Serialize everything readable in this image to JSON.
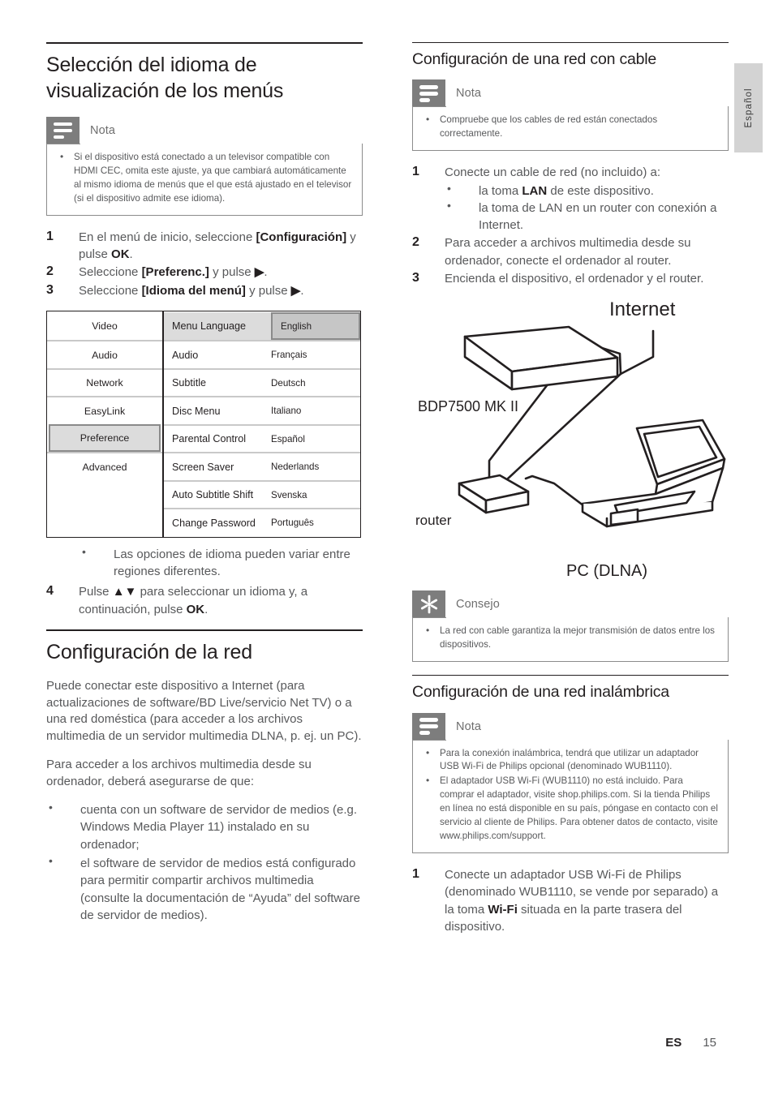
{
  "page": {
    "language_tab": "Español",
    "footer_code": "ES",
    "footer_page": "15"
  },
  "left_column": {
    "heading": "Selección del idioma de visualización de los menús",
    "note": {
      "icon": "note-icon",
      "label": "Nota",
      "items": [
        "Si el dispositivo está conectado a un televisor compatible con HDMI CEC, omita este ajuste, ya que cambiará automáticamente al mismo idioma de menús que el que está ajustado en el televisor (si el dispositivo admite ese idioma)."
      ]
    },
    "steps": [
      {
        "prefix": "En el menú de inicio, seleccione ",
        "bold1": "[Configuración]",
        "middle": " y pulse ",
        "bold2": "OK",
        "suffix": "."
      },
      {
        "prefix": "Seleccione ",
        "bold1": "[Preferenc.]",
        "middle": " y pulse ",
        "bold2": "▶",
        "suffix": "."
      },
      {
        "prefix": "Seleccione ",
        "bold1": "[Idioma del menú]",
        "middle": " y pulse ",
        "bold2": "▶",
        "suffix": "."
      }
    ],
    "osd_menu": {
      "sidebar": [
        {
          "label": "Video",
          "selected": false
        },
        {
          "label": "Audio",
          "selected": false
        },
        {
          "label": "Network",
          "selected": false
        },
        {
          "label": "EasyLink",
          "selected": false
        },
        {
          "label": "Preference",
          "selected": true
        },
        {
          "label": "Advanced",
          "selected": false
        }
      ],
      "rows": [
        {
          "name": "Menu Language",
          "value": "English",
          "highlighted": true
        },
        {
          "name": "Audio",
          "value": "Français",
          "highlighted": false
        },
        {
          "name": "Subtitle",
          "value": "Deutsch",
          "highlighted": false
        },
        {
          "name": "Disc Menu",
          "value": "Italiano",
          "highlighted": false
        },
        {
          "name": "Parental Control",
          "value": "Español",
          "highlighted": false
        },
        {
          "name": "Screen Saver",
          "value": "Nederlands",
          "highlighted": false
        },
        {
          "name": "Auto Subtitle Shift",
          "value": "Svenska",
          "highlighted": false
        },
        {
          "name": "Change Password",
          "value": "Português",
          "highlighted": false
        }
      ]
    },
    "inline_note": "Las opciones de idioma pueden variar entre regiones diferentes.",
    "step4": {
      "prefix": "Pulse ",
      "bold1": "▲▼",
      "middle": " para seleccionar un idioma y, a continuación, pulse ",
      "bold2": "OK",
      "suffix": "."
    },
    "network_heading": "Configuración de la red",
    "paragraphs": [
      "Puede conectar este dispositivo a Internet (para actualizaciones de software/BD Live/servicio Net TV) o a una red doméstica (para acceder a los archivos multimedia de un servidor multimedia DLNA, p. ej. un PC).",
      "Para acceder a los archivos multimedia desde su ordenador, deberá asegurarse de que:"
    ],
    "requirements": [
      "cuenta con un software de servidor de medios (e.g. Windows Media Player 11) instalado en su ordenador;",
      "el software de servidor de medios está configurado para permitir compartir archivos multimedia (consulte la documentación de “Ayuda” del software de servidor de medios)."
    ]
  },
  "right_column": {
    "wired_heading": "Configuración de una red con cable",
    "wired_note": {
      "icon": "note-icon",
      "label": "Nota",
      "items": [
        "Compruebe que los cables de red están conectados correctamente."
      ]
    },
    "wired_steps": [
      {
        "text": "Conecte un cable de red (no incluido) a:",
        "sub": [
          {
            "prefix": "la toma ",
            "bold": "LAN",
            "suffix": " de este dispositivo."
          },
          {
            "prefix": "la toma de LAN en un router con conexión a Internet.",
            "bold": "",
            "suffix": ""
          }
        ]
      },
      {
        "text": "Para acceder a archivos multimedia desde su ordenador, conecte el ordenador al router.",
        "sub": []
      },
      {
        "text": "Encienda el dispositivo, el ordenador y el router.",
        "sub": []
      }
    ],
    "diagram": {
      "internet_label": "Internet",
      "device_label": "BDP7500 MK II",
      "router_label": "router",
      "pc_label": "PC (DLNA)"
    },
    "tip": {
      "icon": "tip-icon",
      "label": "Consejo",
      "items": [
        "La red con cable garantiza la mejor transmisión de datos entre los dispositivos."
      ]
    },
    "wireless_heading": "Configuración de una red inalámbrica",
    "wireless_note": {
      "icon": "note-icon",
      "label": "Nota",
      "items": [
        "Para la conexión inalámbrica, tendrá que utilizar un adaptador USB Wi-Fi de Philips opcional (denominado WUB1110).",
        "El adaptador USB Wi-Fi (WUB1110) no está incluido. Para comprar el adaptador, visite shop.philips.com. Si la tienda Philips en línea no está disponible en su país, póngase en contacto con el servicio al cliente de Philips. Para obtener datos de contacto, visite www.philips.com/support."
      ]
    },
    "wireless_step1": {
      "prefix": "Conecte un adaptador USB Wi-Fi de Philips (denominado WUB1110, se vende por separado) a la toma ",
      "bold": "Wi-Fi",
      "suffix": " situada en la parte trasera del dispositivo."
    }
  }
}
